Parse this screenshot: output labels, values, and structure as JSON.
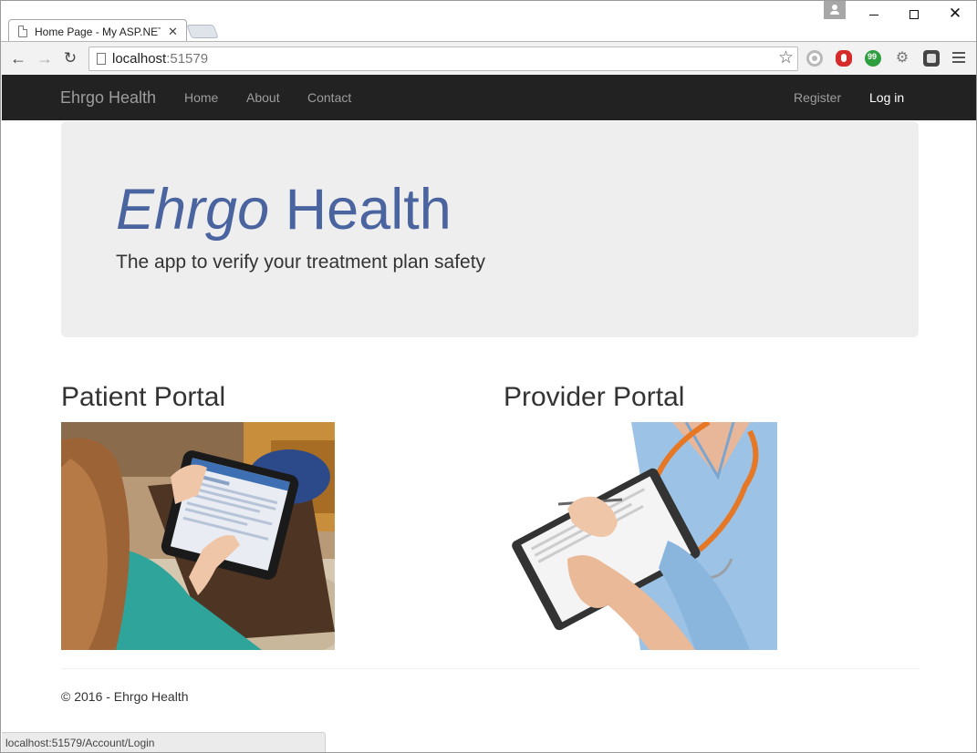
{
  "browser": {
    "tab_title": "Home Page - My ASP.NET",
    "tab_close": "✕",
    "address": {
      "host": "localhost",
      "port": ":51579"
    },
    "status_url": "localhost:51579/Account/Login"
  },
  "navbar": {
    "brand": "Ehrgo Health",
    "links": [
      "Home",
      "About",
      "Contact"
    ],
    "register": "Register",
    "login": "Log in"
  },
  "jumbotron": {
    "title_italic": "Ehrgo",
    "title_rest": " Health",
    "subtitle": "The app to verify your treatment plan safety",
    "title_color": "#4a64a0"
  },
  "portals": {
    "patient": {
      "heading": "Patient Portal",
      "image": "woman-using-tablet-photo"
    },
    "provider": {
      "heading": "Provider Portal",
      "image": "nurse-with-clipboard-photo"
    }
  },
  "footer": {
    "text": "© 2016 - Ehrgo Health"
  }
}
